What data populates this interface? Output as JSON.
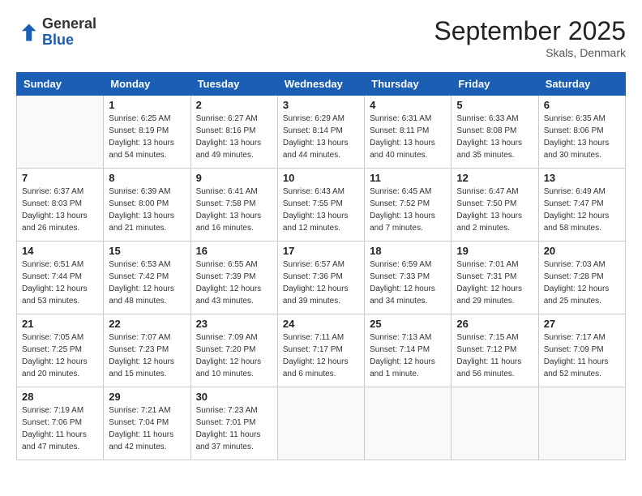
{
  "header": {
    "logo_general": "General",
    "logo_blue": "Blue",
    "month_title": "September 2025",
    "location": "Skals, Denmark"
  },
  "weekdays": [
    "Sunday",
    "Monday",
    "Tuesday",
    "Wednesday",
    "Thursday",
    "Friday",
    "Saturday"
  ],
  "weeks": [
    [
      {
        "day": "",
        "info": ""
      },
      {
        "day": "1",
        "info": "Sunrise: 6:25 AM\nSunset: 8:19 PM\nDaylight: 13 hours\nand 54 minutes."
      },
      {
        "day": "2",
        "info": "Sunrise: 6:27 AM\nSunset: 8:16 PM\nDaylight: 13 hours\nand 49 minutes."
      },
      {
        "day": "3",
        "info": "Sunrise: 6:29 AM\nSunset: 8:14 PM\nDaylight: 13 hours\nand 44 minutes."
      },
      {
        "day": "4",
        "info": "Sunrise: 6:31 AM\nSunset: 8:11 PM\nDaylight: 13 hours\nand 40 minutes."
      },
      {
        "day": "5",
        "info": "Sunrise: 6:33 AM\nSunset: 8:08 PM\nDaylight: 13 hours\nand 35 minutes."
      },
      {
        "day": "6",
        "info": "Sunrise: 6:35 AM\nSunset: 8:06 PM\nDaylight: 13 hours\nand 30 minutes."
      }
    ],
    [
      {
        "day": "7",
        "info": "Sunrise: 6:37 AM\nSunset: 8:03 PM\nDaylight: 13 hours\nand 26 minutes."
      },
      {
        "day": "8",
        "info": "Sunrise: 6:39 AM\nSunset: 8:00 PM\nDaylight: 13 hours\nand 21 minutes."
      },
      {
        "day": "9",
        "info": "Sunrise: 6:41 AM\nSunset: 7:58 PM\nDaylight: 13 hours\nand 16 minutes."
      },
      {
        "day": "10",
        "info": "Sunrise: 6:43 AM\nSunset: 7:55 PM\nDaylight: 13 hours\nand 12 minutes."
      },
      {
        "day": "11",
        "info": "Sunrise: 6:45 AM\nSunset: 7:52 PM\nDaylight: 13 hours\nand 7 minutes."
      },
      {
        "day": "12",
        "info": "Sunrise: 6:47 AM\nSunset: 7:50 PM\nDaylight: 13 hours\nand 2 minutes."
      },
      {
        "day": "13",
        "info": "Sunrise: 6:49 AM\nSunset: 7:47 PM\nDaylight: 12 hours\nand 58 minutes."
      }
    ],
    [
      {
        "day": "14",
        "info": "Sunrise: 6:51 AM\nSunset: 7:44 PM\nDaylight: 12 hours\nand 53 minutes."
      },
      {
        "day": "15",
        "info": "Sunrise: 6:53 AM\nSunset: 7:42 PM\nDaylight: 12 hours\nand 48 minutes."
      },
      {
        "day": "16",
        "info": "Sunrise: 6:55 AM\nSunset: 7:39 PM\nDaylight: 12 hours\nand 43 minutes."
      },
      {
        "day": "17",
        "info": "Sunrise: 6:57 AM\nSunset: 7:36 PM\nDaylight: 12 hours\nand 39 minutes."
      },
      {
        "day": "18",
        "info": "Sunrise: 6:59 AM\nSunset: 7:33 PM\nDaylight: 12 hours\nand 34 minutes."
      },
      {
        "day": "19",
        "info": "Sunrise: 7:01 AM\nSunset: 7:31 PM\nDaylight: 12 hours\nand 29 minutes."
      },
      {
        "day": "20",
        "info": "Sunrise: 7:03 AM\nSunset: 7:28 PM\nDaylight: 12 hours\nand 25 minutes."
      }
    ],
    [
      {
        "day": "21",
        "info": "Sunrise: 7:05 AM\nSunset: 7:25 PM\nDaylight: 12 hours\nand 20 minutes."
      },
      {
        "day": "22",
        "info": "Sunrise: 7:07 AM\nSunset: 7:23 PM\nDaylight: 12 hours\nand 15 minutes."
      },
      {
        "day": "23",
        "info": "Sunrise: 7:09 AM\nSunset: 7:20 PM\nDaylight: 12 hours\nand 10 minutes."
      },
      {
        "day": "24",
        "info": "Sunrise: 7:11 AM\nSunset: 7:17 PM\nDaylight: 12 hours\nand 6 minutes."
      },
      {
        "day": "25",
        "info": "Sunrise: 7:13 AM\nSunset: 7:14 PM\nDaylight: 12 hours\nand 1 minute."
      },
      {
        "day": "26",
        "info": "Sunrise: 7:15 AM\nSunset: 7:12 PM\nDaylight: 11 hours\nand 56 minutes."
      },
      {
        "day": "27",
        "info": "Sunrise: 7:17 AM\nSunset: 7:09 PM\nDaylight: 11 hours\nand 52 minutes."
      }
    ],
    [
      {
        "day": "28",
        "info": "Sunrise: 7:19 AM\nSunset: 7:06 PM\nDaylight: 11 hours\nand 47 minutes."
      },
      {
        "day": "29",
        "info": "Sunrise: 7:21 AM\nSunset: 7:04 PM\nDaylight: 11 hours\nand 42 minutes."
      },
      {
        "day": "30",
        "info": "Sunrise: 7:23 AM\nSunset: 7:01 PM\nDaylight: 11 hours\nand 37 minutes."
      },
      {
        "day": "",
        "info": ""
      },
      {
        "day": "",
        "info": ""
      },
      {
        "day": "",
        "info": ""
      },
      {
        "day": "",
        "info": ""
      }
    ]
  ]
}
